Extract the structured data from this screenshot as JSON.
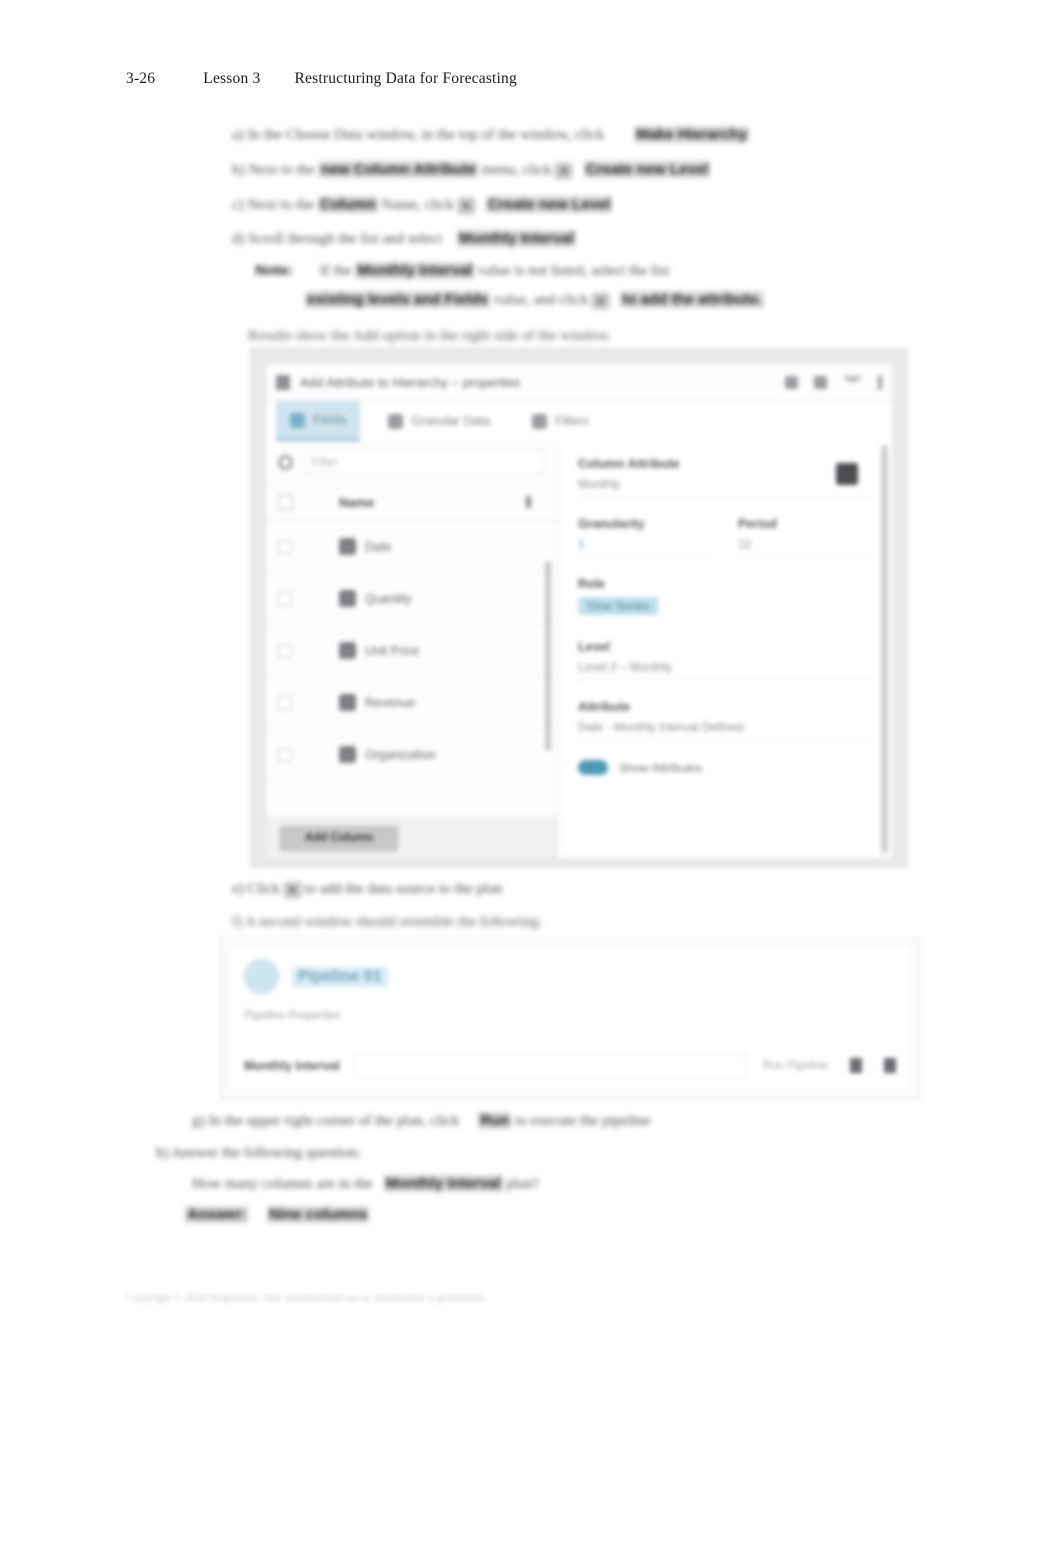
{
  "page_header": {
    "folio": "3-26",
    "lesson": "Lesson 3",
    "title": "Restructuring Data for Forecasting"
  },
  "body_steps": [
    {
      "id": "a",
      "text": "a) In the Choose Data window, in the top of the window, click",
      "emphasis": "Make Hierarchy"
    },
    {
      "id": "b",
      "text": "b) Next to the",
      "emphasis": "new Column Attribute",
      "tail": "menu, click",
      "kbd": "+",
      "emphasis2": "Create new Level"
    },
    {
      "id": "c",
      "text": "c) Next to the",
      "emphasis": "Column",
      "tail": "Name, click",
      "kbd": "+",
      "emphasis2": "Create new Level"
    },
    {
      "id": "d",
      "text": "d) Scroll through the list and select",
      "emphasis": "Monthly Interval"
    },
    {
      "id": "note",
      "label": "Note:",
      "text": "If the",
      "emphasis": "Monthly Interval",
      "tail": "value is not listed, select the list",
      "text2": "existing levels and Fields",
      "tail2": "value, and click",
      "kbd": "+",
      "emphasis2": "to add the attribute."
    },
    {
      "id": "caption",
      "text": "Results show the Add option in the right side of the window."
    },
    {
      "id": "e",
      "text": "e) Click",
      "kbd": "+",
      "tail": "to add the data source to the plan"
    },
    {
      "id": "f",
      "text": "f) A second window should resemble the following:"
    },
    {
      "id": "g",
      "text": "g) In the upper right corner of the plan, click",
      "emphasis": "Run",
      "tail": "to execute the pipeline"
    },
    {
      "id": "h",
      "text": "h) Answer the following question:"
    },
    {
      "id": "q",
      "text": "How many columns are in the",
      "emphasis": "Monthly Interval",
      "tail": "plan?"
    },
    {
      "id": "answer",
      "label": "Answer:",
      "text": "Nine columns"
    }
  ],
  "footer": "Copyright © 2024 Proprietary. Any unauthorized use or distribution is prohibited.",
  "editor_dialog": {
    "titlebar": {
      "icon": "document-icon",
      "title": "Add Attribute to Hierarchy – properties",
      "buttons": [
        "help-icon",
        "settings-icon",
        "chevron-down-icon",
        "kebab-menu-icon"
      ]
    },
    "tabs": [
      {
        "label": "Fields",
        "icon": "fields-icon",
        "active": true
      },
      {
        "label": "Granular Data",
        "icon": "data-icon",
        "active": false
      },
      {
        "label": "Filters",
        "icon": "filter-icon",
        "active": false
      }
    ],
    "search": {
      "icon": "search-icon",
      "placeholder": "Filter"
    },
    "table": {
      "columns": [
        "",
        "Name",
        ""
      ],
      "rows": [
        {
          "checked": false,
          "icon": "column-icon",
          "name": "Date"
        },
        {
          "checked": false,
          "icon": "column-icon",
          "name": "Quantity"
        },
        {
          "checked": false,
          "icon": "column-icon",
          "name": "Unit Price"
        },
        {
          "checked": false,
          "icon": "column-icon",
          "name": "Revenue"
        },
        {
          "checked": false,
          "icon": "column-icon",
          "name": "Organization"
        }
      ]
    },
    "footer_button": "Add Column",
    "properties": [
      {
        "label": "Column Attribute",
        "value": "Monthly",
        "kind": "text"
      },
      {
        "label": "Granularity",
        "value": "1",
        "kind": "teal"
      },
      {
        "label": "Period",
        "value": "12",
        "kind": "text"
      },
      {
        "label": "Role",
        "value": "Time Series",
        "kind": "chip"
      },
      {
        "label": "Level",
        "value": "Level 2 – Monthly",
        "kind": "text"
      },
      {
        "label": "Attribute",
        "value": "Date - Monthly Interval Defined",
        "kind": "text"
      }
    ],
    "toggle": {
      "label": "Show Attributes",
      "on": true
    }
  },
  "prompt_panel": {
    "icon": "info-circle-icon",
    "title": "Pipeline 01",
    "subtitle": "Pipeline Properties",
    "row": {
      "label": "Monthly Interval",
      "input_value": "",
      "unit": "Run Pipeline",
      "icons": [
        "edit-icon",
        "delete-icon"
      ]
    }
  }
}
